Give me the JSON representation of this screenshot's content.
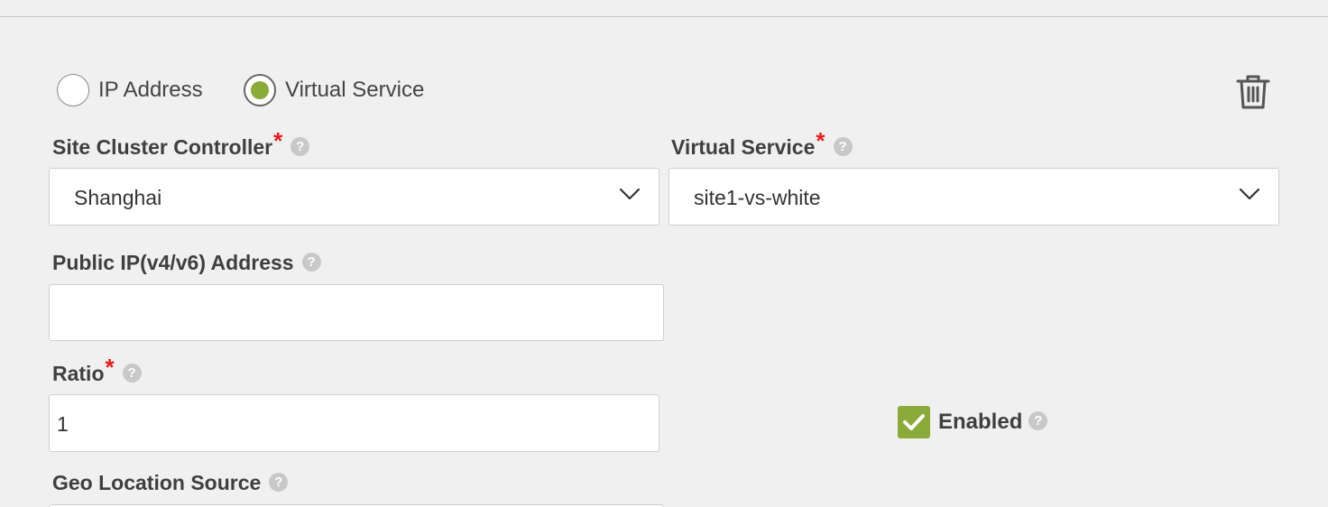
{
  "target_type": {
    "options": [
      {
        "label": "IP Address",
        "selected": false
      },
      {
        "label": "Virtual Service",
        "selected": true
      }
    ]
  },
  "actions": {
    "delete_icon": "trash-icon"
  },
  "fields": {
    "site_cluster_controller": {
      "label": "Site Cluster Controller",
      "required_mark": "*",
      "help_icon": "?",
      "value": "Shanghai"
    },
    "virtual_service": {
      "label": "Virtual Service",
      "required_mark": "*",
      "help_icon": "?",
      "value": "site1-vs-white"
    },
    "public_ip": {
      "label": "Public IP(v4/v6) Address",
      "help_icon": "?",
      "value": ""
    },
    "ratio": {
      "label": "Ratio",
      "required_mark": "*",
      "help_icon": "?",
      "value": "1"
    },
    "enabled": {
      "label": "Enabled",
      "help_icon": "?",
      "checked": true
    },
    "geo_location_source": {
      "label": "Geo Location Source",
      "help_icon": "?"
    }
  },
  "colors": {
    "accent": "#8aaa3a",
    "required": "#e41c1c",
    "background": "#f0f0f0"
  }
}
